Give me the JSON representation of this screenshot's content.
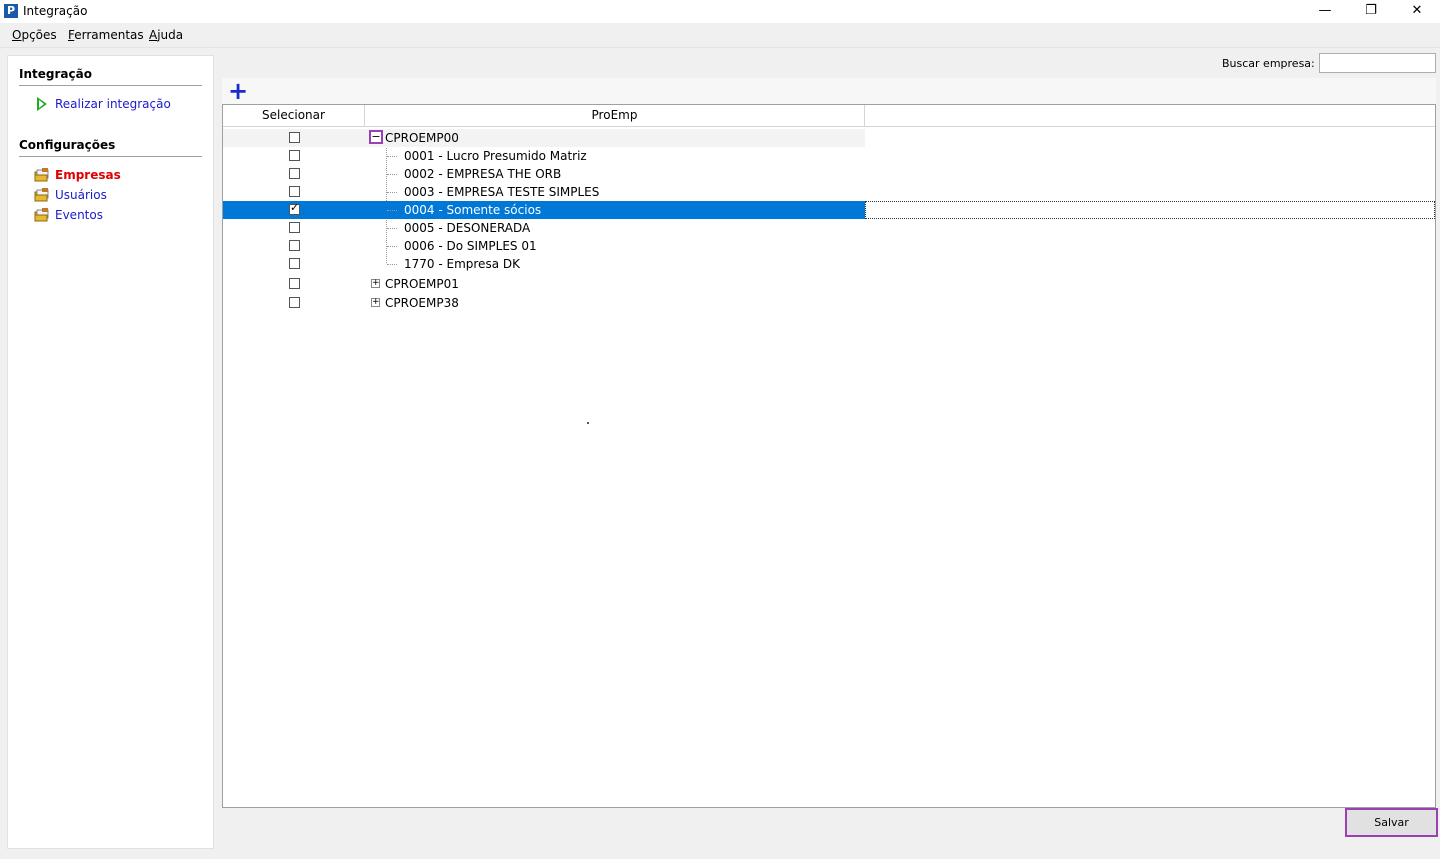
{
  "window": {
    "title": "Integração",
    "app_icon": "P",
    "min_glyph": "—",
    "restore_glyph": "❐",
    "close_glyph": "✕"
  },
  "menu": [
    {
      "u": "O",
      "rest": "pções"
    },
    {
      "u": "F",
      "rest": "erramentas"
    },
    {
      "u": "A",
      "rest": "juda"
    }
  ],
  "sidebar": {
    "integracao_title": "Integração",
    "realizar_label": "Realizar integração",
    "config_title": "Configurações",
    "items": [
      {
        "label": "Empresas",
        "icon": "folder-key-icon"
      },
      {
        "label": "Usuários",
        "icon": "folder-key-icon"
      },
      {
        "label": "Eventos",
        "icon": "folder-key-icon"
      }
    ]
  },
  "search": {
    "label": "Buscar empresa:",
    "value": ""
  },
  "grid": {
    "columns": [
      "Selecionar",
      "ProEmp",
      ""
    ],
    "groups": [
      {
        "name": "CPROEMP00",
        "expanded": true,
        "children": [
          {
            "label": "0001 - Lucro Presumido Matriz",
            "checked": false
          },
          {
            "label": "0002 - EMPRESA THE ORB",
            "checked": false
          },
          {
            "label": "0003 - EMPRESA TESTE SIMPLES",
            "checked": false
          },
          {
            "label": "0004 - Somente sócios",
            "checked": true,
            "selected": true
          },
          {
            "label": "0005 - DESONERADA",
            "checked": false
          },
          {
            "label": "0006 - Do SIMPLES 01",
            "checked": false
          },
          {
            "label": "1770 - Empresa DK",
            "checked": false
          }
        ]
      },
      {
        "name": "CPROEMP01",
        "expanded": false,
        "children": []
      },
      {
        "name": "CPROEMP38",
        "expanded": false,
        "children": []
      }
    ]
  },
  "footer": {
    "save_label": "Salvar"
  },
  "colors": {
    "selection": "#0078d7",
    "active_nav": "#e00000",
    "link": "#1a1acc",
    "highlight_border": "#9b3fb5",
    "add_icon": "#1a2acc"
  }
}
